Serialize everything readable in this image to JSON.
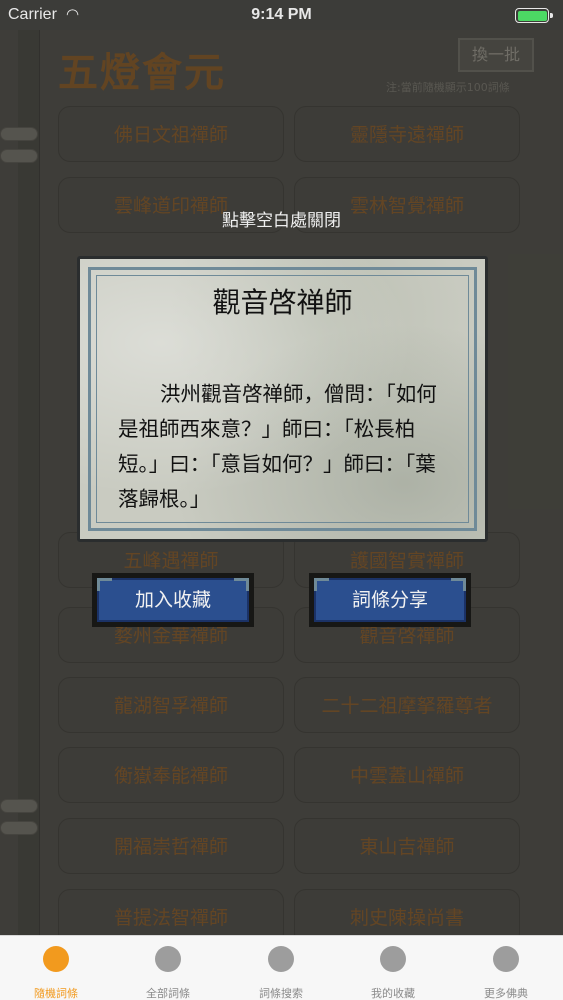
{
  "status_bar": {
    "carrier": "Carrier",
    "time": "9:14 PM",
    "battery_level": 1.0,
    "battery_color": "#4cd964"
  },
  "background": {
    "title": "五燈會元",
    "refresh_label": "換一批",
    "notice": "注:當前隨機顯示100詞條",
    "grid_items": [
      "佛日文祖禪師",
      "靈隱寺遠禪師",
      "雲峰道印禪師",
      "雲林智覺禪師",
      "五峰遇禪師",
      "護國智實禪師",
      "婺州金華禪師",
      "觀音啓禪師",
      "龍湖智孚禪師",
      "二十二祖摩拏羅尊者",
      "衡嶽奉能禪師",
      "中雲蓋山禪師",
      "開福崇哲禪師",
      "東山吉禪師",
      "普提法智禪師",
      "刺史陳操尚書"
    ]
  },
  "modal": {
    "close_hint": "點擊空白處關閉",
    "title": "觀音啓禅師",
    "body": "洪州觀音啓禅師，僧問：「如何是祖師西來意？」師曰：「松長柏短。」曰：「意旨如何？」師曰：「葉落歸根。」",
    "favorite_label": "加入收藏",
    "share_label": "詞條分享"
  },
  "tab_bar": {
    "accent": "#f29a1e",
    "tabs": [
      {
        "label": "隨機詞條",
        "active": true
      },
      {
        "label": "全部詞條",
        "active": false
      },
      {
        "label": "詞條搜索",
        "active": false
      },
      {
        "label": "我的收藏",
        "active": false
      },
      {
        "label": "更多佛典",
        "active": false
      }
    ]
  }
}
